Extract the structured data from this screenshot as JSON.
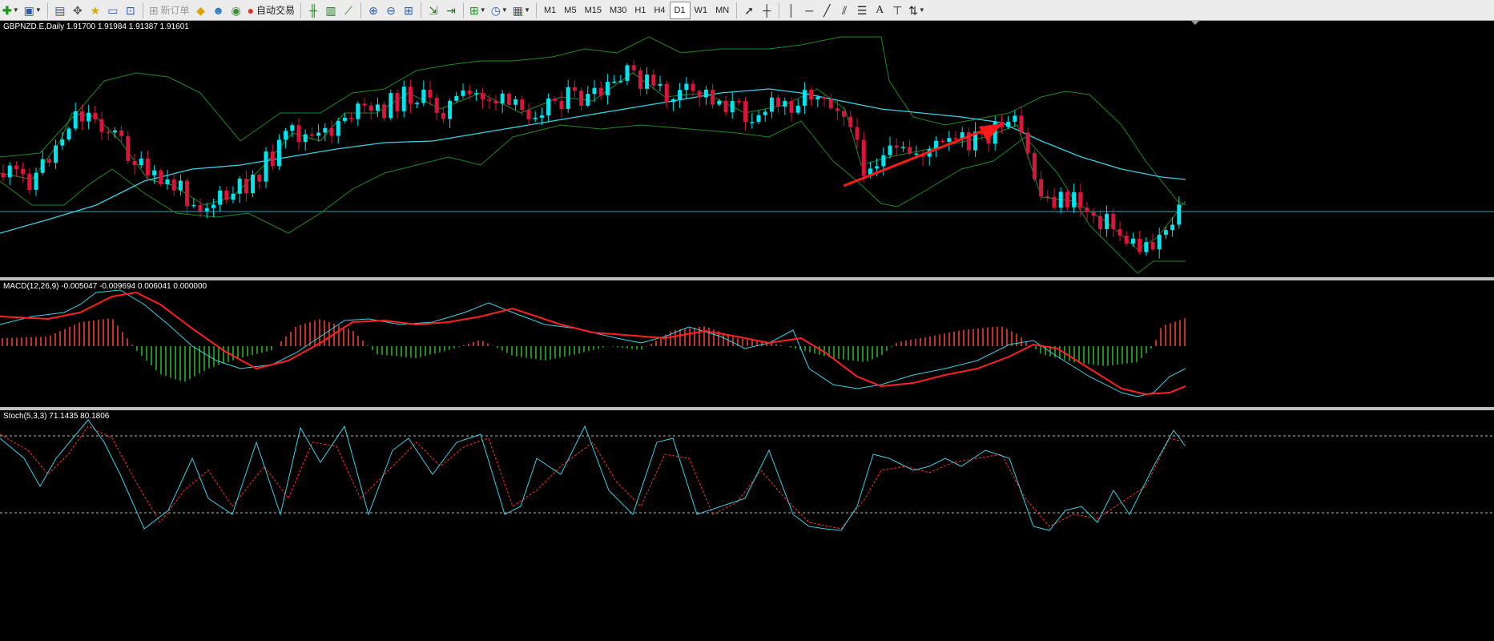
{
  "toolbar": {
    "new_order_label": "新订单",
    "auto_trading_label": "自动交易",
    "timeframes": [
      "M1",
      "M5",
      "M15",
      "M30",
      "H1",
      "H4",
      "D1",
      "W1",
      "MN"
    ],
    "active_timeframe": "D1"
  },
  "main_panel": {
    "label": "GBPNZD.E,Daily  1.91700 1.91984 1.91387 1.91601"
  },
  "macd_panel": {
    "label": "MACD(12,26,9) -0.005047 -0.009694 0.006041 0.000000"
  },
  "stoch_panel": {
    "label": "Stoch(5,3,3) 71.1435 80.1806"
  },
  "colors": {
    "bull_candle": "#00e5ee",
    "bear_candle": "#dc143c",
    "bollinger": "#1e8c1e",
    "moving_average": "#3ad0e6",
    "macd_histogram_pos": "#c0302a",
    "macd_histogram_neg": "#1e8c1e",
    "macd_signal": "#ff2020",
    "stoch_main": "#3ad0e6",
    "stoch_signal": "#ff3030",
    "annotation_arrow": "#ff1a1a"
  }
}
